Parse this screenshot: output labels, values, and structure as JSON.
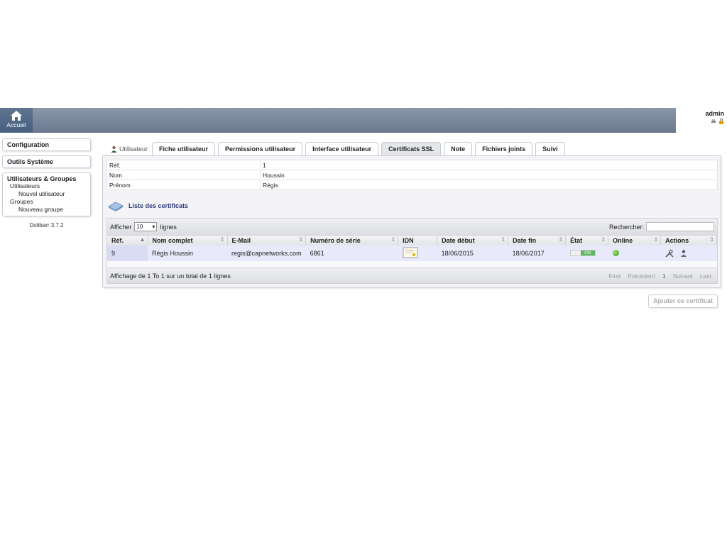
{
  "topbar": {
    "home_label": "Accueil",
    "user_name": "admin"
  },
  "sidebar": {
    "blocks": [
      {
        "title": "Configuration"
      },
      {
        "title": "Outils Système"
      },
      {
        "title": "Utilisateurs & Groupes",
        "items": [
          "Utilisateurs",
          "Nouvel utilisateur",
          "Groupes",
          "Nouveau groupe"
        ]
      }
    ],
    "version": "Dolibarr 3.7.2"
  },
  "tabs": {
    "head_label": "Utilisateur",
    "items": [
      "Fiche utilisateur",
      "Permissions utilisateur",
      "Interface utilisateur",
      "Certificats SSL",
      "Note",
      "Fichiers joints",
      "Suivi"
    ],
    "active": "Certificats SSL"
  },
  "info": {
    "rows": [
      {
        "label": "Réf.",
        "value": "1"
      },
      {
        "label": "Nom",
        "value": "Houssin"
      },
      {
        "label": "Prénom",
        "value": "Régis"
      }
    ]
  },
  "certificates": {
    "title": "Liste des certificats",
    "show_label": "Afficher",
    "page_size": "10",
    "lines_label": "lignes",
    "search_label": "Rechercher:",
    "search_value": "",
    "columns": [
      "Réf.",
      "Nom complet",
      "E-Mail",
      "Numéro de série",
      "IDN",
      "Date début",
      "Date fin",
      "État",
      "Online",
      "Actions"
    ],
    "rows": [
      {
        "ref": "9",
        "name": "Régis Houssin",
        "email": "regis@capnetworks.com",
        "serial": "6861",
        "start": "18/06/2015",
        "end": "18/06/2017",
        "state": "ON"
      }
    ],
    "summary": "Affichage de 1 To 1 sur un total de 1 lignes",
    "pager": {
      "first": "First",
      "prev": "Précédent",
      "page": "1",
      "next": "Suivant",
      "last": "Last"
    },
    "add_button": "Ajouter ce certificat"
  },
  "colors": {
    "topbar": "#7a879b",
    "row_bg": "#e8eafb",
    "online": "#3c9a1e",
    "switch_on": "#5cb85c",
    "title_link": "#2b3a7a"
  }
}
